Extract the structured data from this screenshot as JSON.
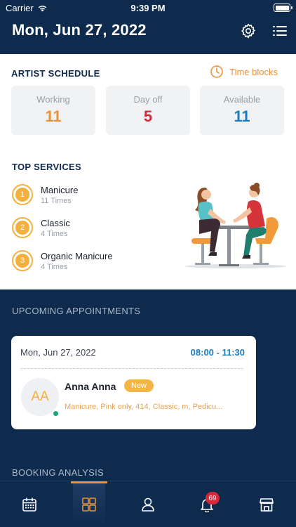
{
  "status_bar": {
    "carrier": "Carrier",
    "time": "9:39 PM"
  },
  "header": {
    "title": "Mon, Jun 27, 2022",
    "icons": [
      "gear-icon",
      "list-icon"
    ]
  },
  "artist_schedule": {
    "title": "ARTIST SCHEDULE",
    "time_blocks_label": "Time blocks",
    "stats": [
      {
        "label": "Working",
        "value": "11",
        "color": "#e8923a"
      },
      {
        "label": "Day off",
        "value": "5",
        "color": "#d4293a"
      },
      {
        "label": "Available",
        "value": "11",
        "color": "#1a7cc1"
      }
    ]
  },
  "top_services": {
    "title": "TOP SERVICES",
    "items": [
      {
        "rank": "1",
        "name": "Manicure",
        "times": "11 Times"
      },
      {
        "rank": "2",
        "name": "Classic",
        "times": "4 Times"
      },
      {
        "rank": "3",
        "name": "Organic Manicure",
        "times": "4 Times"
      }
    ]
  },
  "upcoming": {
    "title": "UPCOMING APPOINTMENTS",
    "appointment": {
      "date": "Mon, Jun 27, 2022",
      "time_range": "08:00 - 11:30",
      "initials": "AA",
      "client": "Anna Anna",
      "badge": "New",
      "services": "Manicure, Pink only, 414, Classic, m, Pedicu..."
    }
  },
  "booking_analysis": {
    "title": "BOOKING ANALYSIS"
  },
  "nav": {
    "items": [
      "calendar-icon",
      "dashboard-icon",
      "profile-icon",
      "bell-icon",
      "store-icon"
    ],
    "active": "dashboard-icon",
    "notification_count": "69"
  },
  "colors": {
    "navy": "#0e2a4d",
    "accent": "#e8923a",
    "gold": "#f2b13e"
  }
}
